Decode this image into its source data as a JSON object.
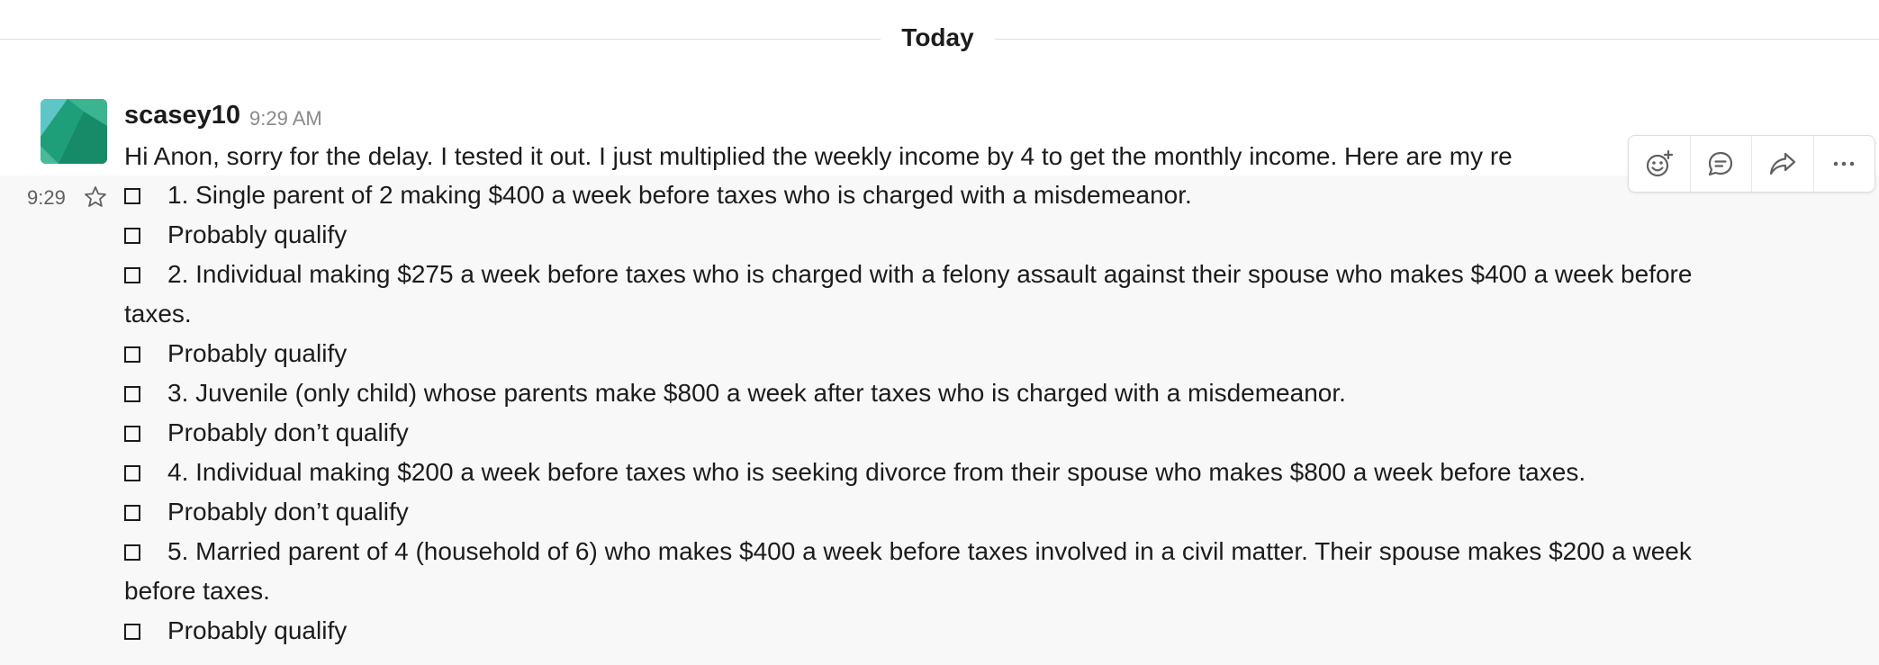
{
  "divider": {
    "label": "Today"
  },
  "message": {
    "username": "scasey10",
    "timestamp": "9:29 AM",
    "first_line": "Hi Anon, sorry for the delay.  I tested it out.  I just multiplied the weekly income by 4 to get the monthly income.  Here are my re",
    "hover_time": "9:29",
    "items": [
      "1. Single parent of 2 making $400 a week before taxes who is charged with a misdemeanor.",
      "Probably qualify",
      "2. Individual making $275 a week before taxes who is charged with a felony assault against their spouse who makes $400 a week before",
      "taxes.",
      "Probably qualify",
      "3. Juvenile (only child) whose parents make $800 a week after taxes who is charged with a misdemeanor.",
      "Probably don’t qualify",
      "4. Individual making $200 a week before taxes who is seeking divorce from their spouse who makes $800 a week before taxes.",
      "Probably don’t qualify",
      "5. Married parent of 4 (household of 6) who makes $400 a week before taxes involved in a civil matter. Their spouse makes $200 a week",
      "before taxes.",
      "Probably qualify"
    ]
  },
  "icons": {
    "star": "star-icon",
    "add_reaction": "add-reaction-icon",
    "reply_thread": "reply-thread-icon",
    "share": "share-icon",
    "more": "more-actions-icon"
  },
  "colors": {
    "avatar_primary": "#1f9e7a",
    "avatar_light": "#56c2b8",
    "hover_bg": "#f8f8f8",
    "divider_line": "#dddddd"
  }
}
